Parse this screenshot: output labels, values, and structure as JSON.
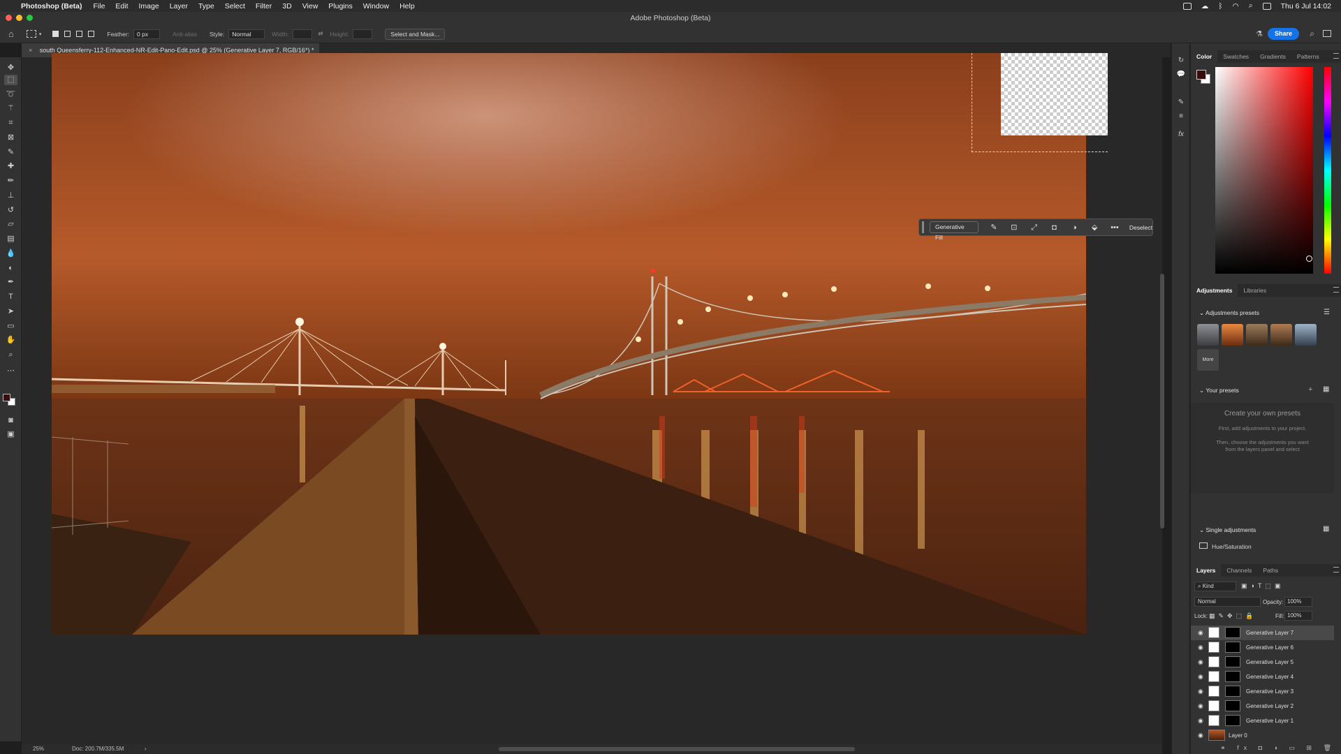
{
  "menubar": {
    "app_name": "Photoshop (Beta)",
    "items": [
      "File",
      "Edit",
      "Image",
      "Layer",
      "Type",
      "Select",
      "Filter",
      "3D",
      "View",
      "Plugins",
      "Window",
      "Help"
    ],
    "clock": "Thu 6 Jul  14:02"
  },
  "window": {
    "title": "Adobe Photoshop (Beta)"
  },
  "options": {
    "feather_label": "Feather:",
    "feather_value": "0 px",
    "anti_alias_label": "Anti-alias",
    "style_label": "Style:",
    "style_value": "Normal",
    "width_label": "Width:",
    "height_label": "Height:",
    "select_mask_label": "Select and Mask...",
    "share_label": "Share"
  },
  "document": {
    "tab_title": "south Queensferry-112-Enhanced-NR-Edit-Pano-Edit.psd @ 25% (Generative Layer 7, RGB/16*) *"
  },
  "taskbar": {
    "generative_fill_label": "Generative Fill",
    "deselect_label": "Deselect"
  },
  "status": {
    "zoom": "25%",
    "doc": "Doc: 200.7M/335.5M"
  },
  "color_panel": {
    "tabs": [
      "Color",
      "Swatches",
      "Gradients",
      "Patterns"
    ],
    "foreground": "#3a0c0c",
    "background": "#ffffff"
  },
  "adjustments": {
    "tabs": [
      "Adjustments",
      "Libraries"
    ],
    "presets_title": "Adjustments presets",
    "more_label": "More",
    "your_presets_title": "Your presets",
    "create_title": "Create your own presets",
    "create_line1": "First, add adjustments to your project.",
    "create_line2": "Then, choose the adjustments you want",
    "create_line3": "from the layers panel and select",
    "single_title": "Single adjustments",
    "hue_sat_label": "Hue/Saturation"
  },
  "layers": {
    "tabs": [
      "Layers",
      "Channels",
      "Paths"
    ],
    "kind_label": "Kind",
    "blend_mode": "Normal",
    "opacity_label": "Opacity:",
    "opacity_value": "100%",
    "lock_label": "Lock:",
    "fill_label": "Fill:",
    "fill_value": "100%",
    "items": [
      {
        "name": "Generative Layer 7"
      },
      {
        "name": "Generative Layer 6"
      },
      {
        "name": "Generative Layer 5"
      },
      {
        "name": "Generative Layer 4"
      },
      {
        "name": "Generative Layer 3"
      },
      {
        "name": "Generative Layer 2"
      },
      {
        "name": "Generative Layer 1"
      },
      {
        "name": "Layer 0"
      }
    ]
  }
}
